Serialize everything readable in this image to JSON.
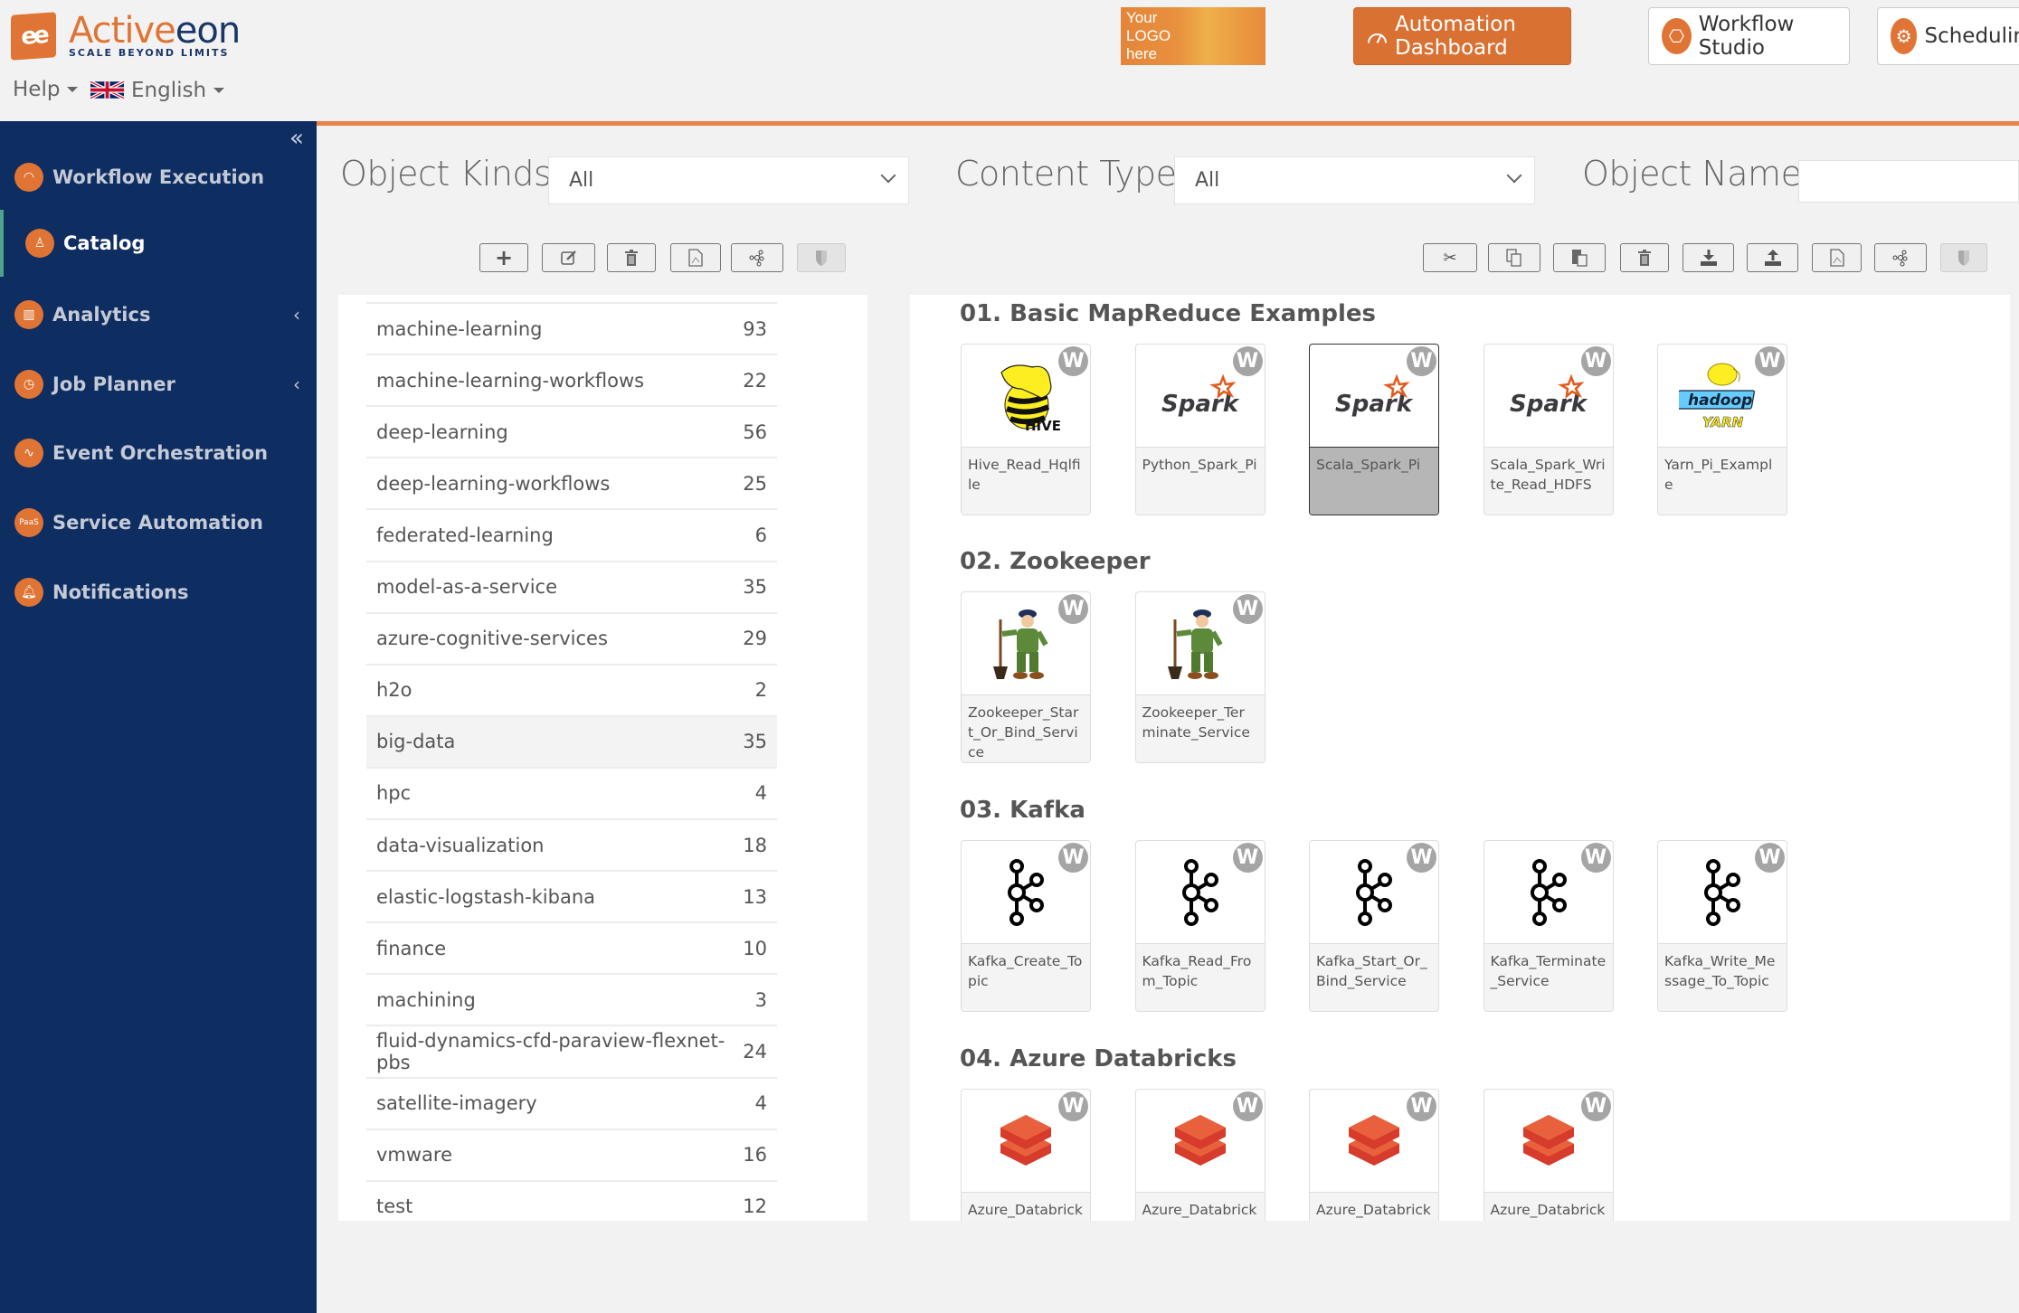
{
  "header": {
    "brand_name_part1": "Active",
    "brand_name_part2": "eon",
    "brand_tagline": "SCALE BEYOND LIMITS",
    "help_label": "Help",
    "language_label": "English",
    "custom_logo_text": [
      "Your",
      "LOGO",
      "here"
    ],
    "nav_buttons": [
      {
        "label": "Automation Dashboard",
        "icon": "gauge-icon",
        "active": true
      },
      {
        "label": "Workflow Studio",
        "icon": "workflow-icon",
        "active": false
      },
      {
        "label": "Schedulin",
        "icon": "gears-icon",
        "active": false
      }
    ]
  },
  "sidebar": {
    "items": [
      {
        "label": "Workflow Execution",
        "icon": "gauge-icon",
        "active": false,
        "expandable": false
      },
      {
        "label": "Catalog",
        "icon": "catalog-icon",
        "active": true,
        "expandable": false
      },
      {
        "label": "Analytics",
        "icon": "analytics-icon",
        "active": false,
        "expandable": true
      },
      {
        "label": "Job Planner",
        "icon": "clock-icon",
        "active": false,
        "expandable": true
      },
      {
        "label": "Event Orchestration",
        "icon": "pulse-icon",
        "active": false,
        "expandable": false
      },
      {
        "label": "Service Automation",
        "icon": "paas-icon",
        "active": false,
        "expandable": false
      },
      {
        "label": "Notifications",
        "icon": "bell-icon",
        "active": false,
        "expandable": false
      }
    ],
    "paas_icon_text": "PaaS"
  },
  "filters": {
    "object_kinds_label": "Object Kinds:",
    "object_kinds_value": "All",
    "content_type_label": "Content Type:",
    "content_type_value": "All",
    "object_name_label": "Object Name:",
    "object_name_value": ""
  },
  "bucket_toolbar": [
    "add",
    "edit",
    "delete",
    "pdf-report",
    "graph",
    "access-control"
  ],
  "object_toolbar": [
    "cut",
    "copy",
    "paste",
    "delete",
    "download",
    "upload",
    "pdf-report",
    "graph",
    "access-control"
  ],
  "buckets": [
    {
      "name": "machine-learning",
      "count": "93"
    },
    {
      "name": "machine-learning-workflows",
      "count": "22"
    },
    {
      "name": "deep-learning",
      "count": "56"
    },
    {
      "name": "deep-learning-workflows",
      "count": "25"
    },
    {
      "name": "federated-learning",
      "count": "6"
    },
    {
      "name": "model-as-a-service",
      "count": "35"
    },
    {
      "name": "azure-cognitive-services",
      "count": "29"
    },
    {
      "name": "h2o",
      "count": "2"
    },
    {
      "name": "big-data",
      "count": "35",
      "selected": true
    },
    {
      "name": "hpc",
      "count": "4"
    },
    {
      "name": "data-visualization",
      "count": "18"
    },
    {
      "name": "elastic-logstash-kibana",
      "count": "13"
    },
    {
      "name": "finance",
      "count": "10"
    },
    {
      "name": "machining",
      "count": "3"
    },
    {
      "name": "fluid-dynamics-cfd-paraview-flexnet-pbs",
      "count": "24"
    },
    {
      "name": "satellite-imagery",
      "count": "4"
    },
    {
      "name": "vmware",
      "count": "16"
    },
    {
      "name": "test",
      "count": "12"
    }
  ],
  "sections": [
    {
      "title": "01. Basic MapReduce Examples",
      "objects": [
        {
          "name": "Hive_Read_Hqlfile",
          "icon": "hive",
          "badge": "W"
        },
        {
          "name": "Python_Spark_Pi",
          "icon": "spark",
          "badge": "W"
        },
        {
          "name": "Scala_Spark_Pi",
          "icon": "spark",
          "badge": "W",
          "selected": true
        },
        {
          "name": "Scala_Spark_Write_Read_HDFS",
          "icon": "spark",
          "badge": "W"
        },
        {
          "name": "Yarn_Pi_Example",
          "icon": "hadoop-yarn",
          "badge": "W"
        }
      ]
    },
    {
      "title": "02. Zookeeper",
      "objects": [
        {
          "name": "Zookeeper_Start_Or_Bind_Service",
          "icon": "zookeeper",
          "badge": "W"
        },
        {
          "name": "Zookeeper_Terminate_Service",
          "icon": "zookeeper",
          "badge": "W"
        }
      ]
    },
    {
      "title": "03. Kafka",
      "objects": [
        {
          "name": "Kafka_Create_Topic",
          "icon": "kafka",
          "badge": "W"
        },
        {
          "name": "Kafka_Read_From_Topic",
          "icon": "kafka",
          "badge": "W"
        },
        {
          "name": "Kafka_Start_Or_Bind_Service",
          "icon": "kafka",
          "badge": "W"
        },
        {
          "name": "Kafka_Terminate_Service",
          "icon": "kafka",
          "badge": "W"
        },
        {
          "name": "Kafka_Write_Message_To_Topic",
          "icon": "kafka",
          "badge": "W"
        }
      ]
    },
    {
      "title": "04. Azure Databricks",
      "objects": [
        {
          "name": "Azure_Databrick",
          "icon": "databricks",
          "badge": "W"
        },
        {
          "name": "Azure_Databrick",
          "icon": "databricks",
          "badge": "W"
        },
        {
          "name": "Azure_Databrick",
          "icon": "databricks",
          "badge": "W"
        },
        {
          "name": "Azure_Databrick",
          "icon": "databricks",
          "badge": "W"
        }
      ]
    }
  ],
  "colors": {
    "brand_orange": "#e07434",
    "sidebar_bg": "#0e2d61",
    "active_accent": "#4fa38a",
    "badge_gray": "#a5a5a5"
  }
}
